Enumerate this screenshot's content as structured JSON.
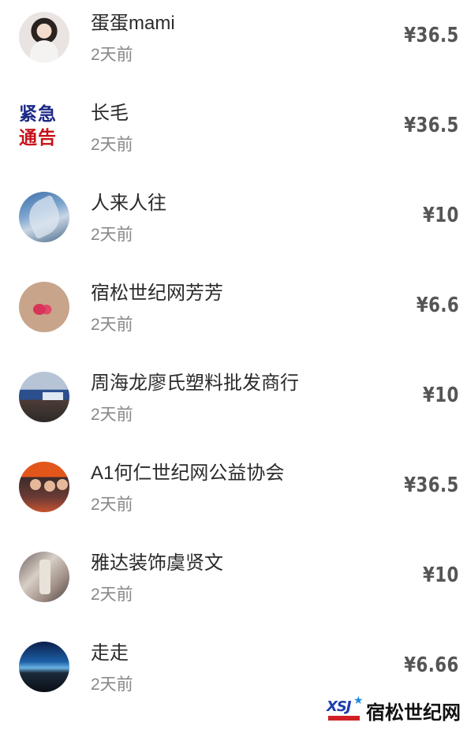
{
  "rows": [
    {
      "name": "蛋蛋mami",
      "time": "2天前",
      "amount": "¥36.5",
      "avatar": "person-portrait"
    },
    {
      "name": "长毛",
      "time": "2天前",
      "amount": "¥36.5",
      "avatar": "urgent-notice",
      "avatar_text": [
        "紧急",
        "通告"
      ]
    },
    {
      "name": "人来人往",
      "time": "2天前",
      "amount": "¥10",
      "avatar": "leaves-photo"
    },
    {
      "name": "宿松世纪网芳芳",
      "time": "2天前",
      "amount": "¥6.6",
      "avatar": "flowers-photo"
    },
    {
      "name": "周海龙廖氏塑料批发商行",
      "time": "2天前",
      "amount": "¥10",
      "avatar": "shop-photo"
    },
    {
      "name": "A1何仁世纪网公益协会",
      "time": "2天前",
      "amount": "¥36.5",
      "avatar": "group-photo"
    },
    {
      "name": "雅达装饰虞贤文",
      "time": "2天前",
      "amount": "¥10",
      "avatar": "room-photo"
    },
    {
      "name": "走走",
      "time": "2天前",
      "amount": "¥6.66",
      "avatar": "earth-photo"
    }
  ],
  "watermark": {
    "text": "宿松世纪网",
    "logo": "XSJ"
  }
}
